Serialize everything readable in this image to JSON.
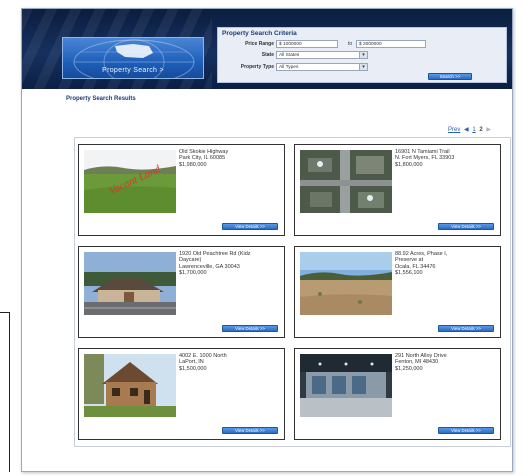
{
  "header": {
    "logo_label": "Property Search >"
  },
  "criteria": {
    "title": "Property Search Criteria",
    "price_range_label": "Price Range",
    "price_from": "$ 1000000",
    "to_label": "to",
    "price_to": "$ 2000000",
    "state_label": "State",
    "state_value": "All States",
    "property_type_label": "Property Type",
    "property_type_value": "All Types",
    "search_button": "Search >>"
  },
  "results": {
    "title": "Property Search Results",
    "pager": {
      "prev": "Prev",
      "arrow": "◀",
      "pages": [
        "1",
        "2"
      ],
      "current": "2",
      "next_arrow": "▶"
    },
    "listings": [
      {
        "line1": "Old Skokie Highway",
        "line2": "Park City, IL 60085",
        "line3": "$1,980,000",
        "line4": "",
        "photo_overlay": "Vacant Land",
        "button": "View Details >>"
      },
      {
        "line1": "16901 N Tamiami Trail",
        "line2": "N. Fort Myers, FL 33903",
        "line3": "$1,800,000",
        "line4": "",
        "photo_overlay": "",
        "button": "View Details >>"
      },
      {
        "line1": "1920 Old Peachtree Rd (Kidz",
        "line2": "Daycare)",
        "line3": "Lawrenceville, GA 30043",
        "line4": "$1,700,000",
        "photo_overlay": "",
        "button": "View Details >>"
      },
      {
        "line1": "88.92 Acres, Phase I,",
        "line2": "Preserve at",
        "line3": "Ocala, FL 34476",
        "line4": "$1,556,100",
        "photo_overlay": "",
        "button": "View Details >>"
      },
      {
        "line1": "4002 E. 1000 North",
        "line2": "LaPort, IN",
        "line3": "$1,500,000",
        "line4": "",
        "photo_overlay": "",
        "button": "View Details >>"
      },
      {
        "line1": "291 North Alloy Drive",
        "line2": "Fenton, MI 48430",
        "line3": "$1,250,000",
        "line4": "",
        "photo_overlay": "",
        "button": "View Details >>"
      }
    ]
  },
  "colors": {
    "header_navy": "#0b1d3f",
    "accent_blue": "#2a6cc6",
    "title_blue": "#1b3c78"
  }
}
